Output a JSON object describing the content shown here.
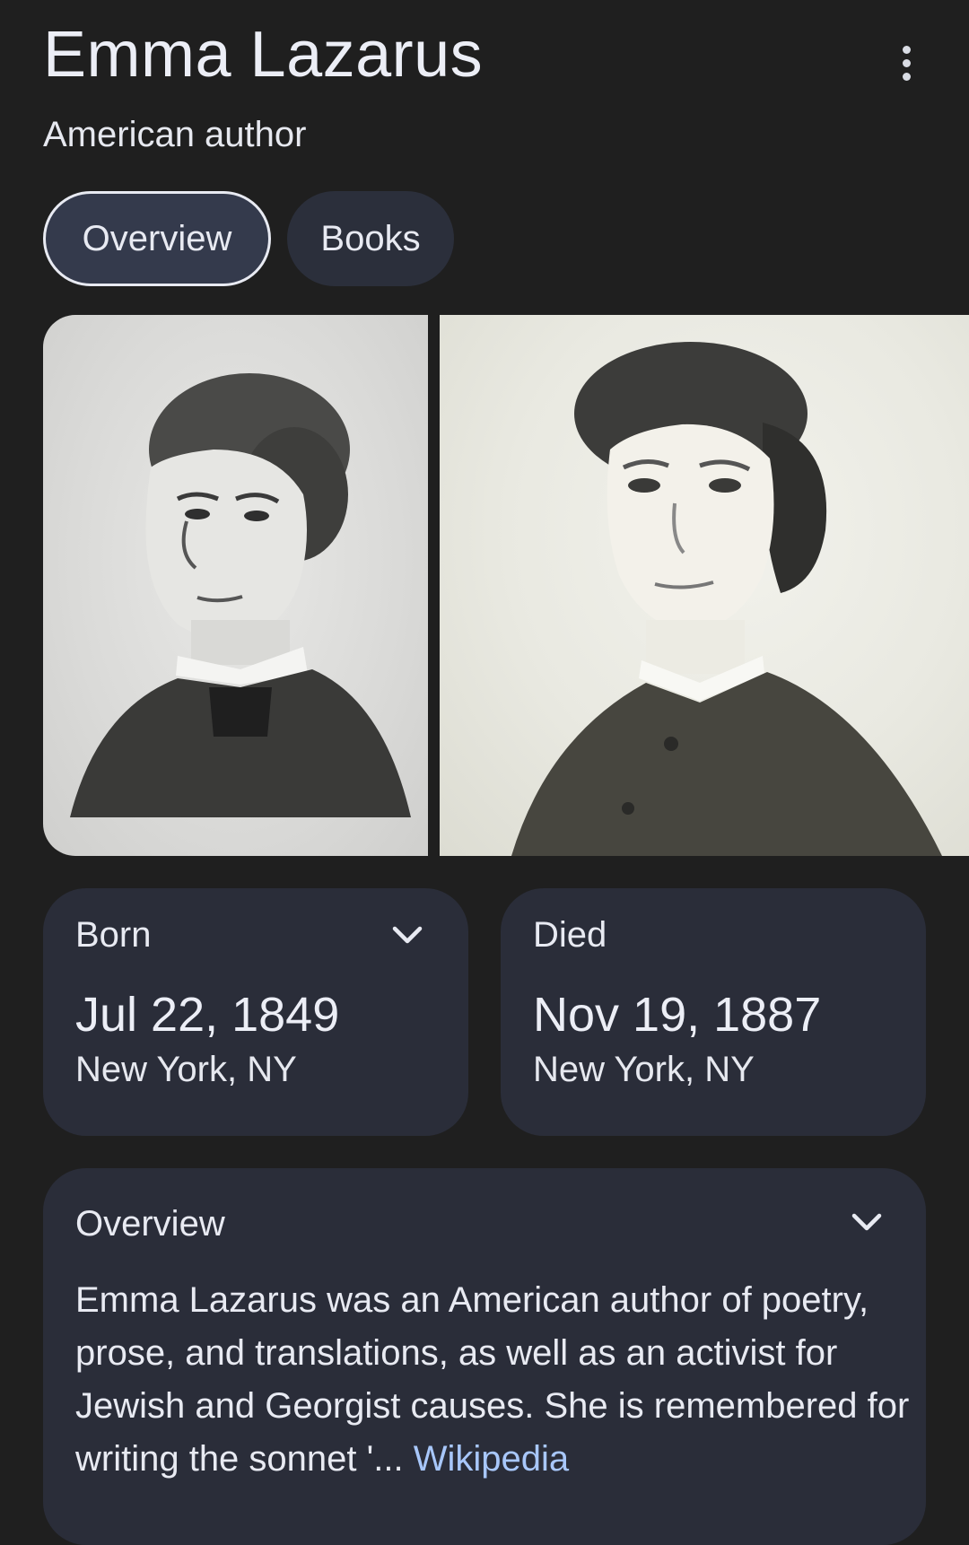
{
  "entity": {
    "name": "Emma Lazarus",
    "description": "American author"
  },
  "header": {
    "more_icon": "more-vert-icon"
  },
  "tabs": [
    {
      "label": "Overview",
      "active": true
    },
    {
      "label": "Books",
      "active": false
    }
  ],
  "facts": {
    "born": {
      "label": "Born",
      "date": "Jul 22, 1849",
      "place": "New York, NY",
      "icon": "chevron-down-icon"
    },
    "died": {
      "label": "Died",
      "date": "Nov 19, 1887",
      "place": "New York, NY"
    }
  },
  "overview": {
    "label": "Overview",
    "text": "Emma Lazarus was an American author of poetry, prose, and translations, as well as an activist for Jewish and Georgist causes. She is remembered for writing the sonnet '...",
    "source_link": "Wikipedia",
    "icon": "chevron-down-icon"
  },
  "colors": {
    "background": "#1f1f1f",
    "card": "#2a2d39",
    "chip": "#2b2f3b",
    "link": "#a8c7fa",
    "text": "#e8eaf2"
  }
}
